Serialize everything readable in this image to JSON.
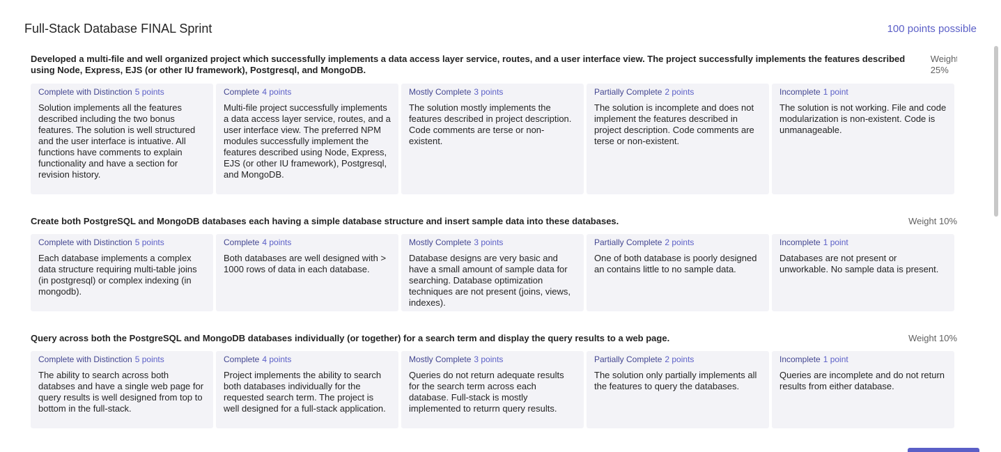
{
  "header": {
    "title": "Full-Stack Database FINAL Sprint",
    "points_possible": "100 points possible"
  },
  "criteria": [
    {
      "description": "Developed a multi-file and well organized project which successfully implements a data access layer service, routes, and a user interface view. The project successfully implements the features described using Node, Express, EJS (or other IU framework), Postgresql, and MongoDB.",
      "weight_label": "Weight",
      "weight_value": "25%",
      "levels": [
        {
          "name": "Complete with Distinction",
          "points": "5 points",
          "text": "Solution implements all the features described including the two bonus features. The solution is well structured and the user interface is intuative. All functions have comments to explain functionality and have a section for revision history."
        },
        {
          "name": "Complete",
          "points": "4 points",
          "text": "Multi-file project successfully implements a data access layer service, routes, and a user interface view. The preferred NPM modules successfully implement the features described using Node, Express, EJS (or other IU framework), Postgresql, and MongoDB."
        },
        {
          "name": "Mostly Complete",
          "points": "3 points",
          "text": "The solution mostly implements the features described in project description. Code comments are terse or non-existent."
        },
        {
          "name": "Partially Complete",
          "points": "2 points",
          "text": "The solution is incomplete and does not implement the features described in project description. Code comments are terse or non-existent."
        },
        {
          "name": "Incomplete",
          "points": "1 point",
          "text": "The solution is not working. File and code modularization is non-existent. Code is unmanageable."
        }
      ]
    },
    {
      "description": "Create both PostgreSQL and MongoDB databases each having a simple database structure and insert sample data into these databases.",
      "weight_label": "Weight 10%",
      "weight_value": "",
      "levels": [
        {
          "name": "Complete with Distinction",
          "points": "5 points",
          "text": "Each database implements a complex data structure requiring multi-table joins (in postgresql) or complex indexing (in mongodb)."
        },
        {
          "name": "Complete",
          "points": "4 points",
          "text": "Both databases are well designed with > 1000 rows of data in each database."
        },
        {
          "name": "Mostly Complete",
          "points": "3 points",
          "text": "Database designs are very basic and have a small amount of sample data for searching. Database optimization techniques are not present (joins, views, indexes)."
        },
        {
          "name": "Partially Complete",
          "points": "2 points",
          "text": "One of both database is poorly designed an contains little to no sample data."
        },
        {
          "name": "Incomplete",
          "points": "1 point",
          "text": "Databases are not present or unworkable. No sample data is present."
        }
      ]
    },
    {
      "description": "Query across both the PostgreSQL and MongoDB databases individually (or together) for a search term and display the query results to a web page.",
      "weight_label": "Weight 10%",
      "weight_value": "",
      "levels": [
        {
          "name": "Complete with Distinction",
          "points": "5 points",
          "text": "The ability to search across both databses and have a single web page for query results is well designed from top to bottom in the full-stack."
        },
        {
          "name": "Complete",
          "points": "4 points",
          "text": "Project implements the ability to search both databases individually for the requested search term. The project is well designed for a full-stack application."
        },
        {
          "name": "Mostly Complete",
          "points": "3 points",
          "text": "Queries do not return adequate results for the search term across each database. Full-stack is mostly implemented to returrn query results."
        },
        {
          "name": "Partially Complete",
          "points": "2 points",
          "text": "The solution only partially implements all the features to query the databases."
        },
        {
          "name": "Incomplete",
          "points": "1 point",
          "text": "Queries are incomplete and do not return results from either database."
        }
      ]
    }
  ]
}
